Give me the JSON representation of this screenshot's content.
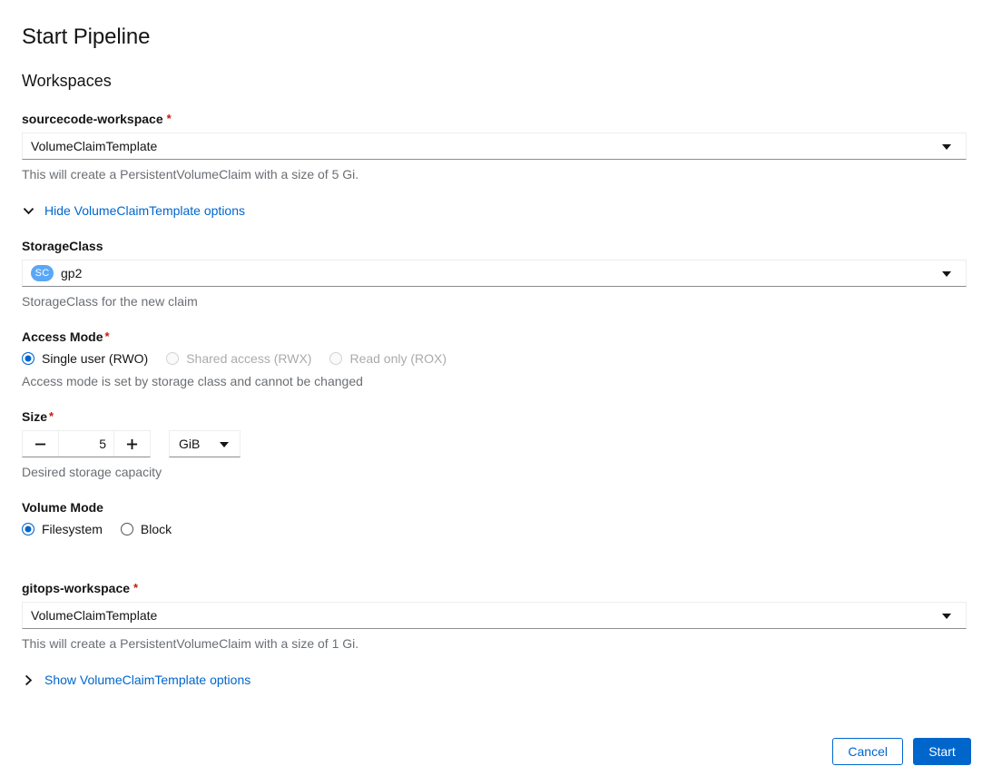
{
  "page": {
    "title": "Start Pipeline",
    "section_title": "Workspaces"
  },
  "colors": {
    "accent_blue": "#06c",
    "required_red": "#c9190b",
    "badge_blue": "#5ba7f7",
    "helper_gray": "#6a6e73",
    "disabled_gray": "#aaabac"
  },
  "workspaces": [
    {
      "name": "sourcecode-workspace",
      "required_marker": "*",
      "type_select": {
        "value": "VolumeClaimTemplate",
        "caret_icon": "chevron-down-icon"
      },
      "helper_text": "This will create a PersistentVolumeClaim with a size of 5 Gi.",
      "expandable": {
        "label": "Hide VolumeClaimTemplate options",
        "chevron_icon": "chevron-down-icon",
        "expanded": true
      },
      "options": {
        "storage_class": {
          "label": "StorageClass",
          "badge": "SC",
          "value": "gp2",
          "helper_text": "StorageClass for the new claim",
          "caret_icon": "chevron-down-icon"
        },
        "access_mode": {
          "label": "Access Mode",
          "required_marker": "*",
          "helper_text": "Access mode is set by storage class and cannot be changed",
          "options": [
            {
              "label": "Single user (RWO)",
              "checked": true,
              "disabled": false
            },
            {
              "label": "Shared access (RWX)",
              "checked": false,
              "disabled": true
            },
            {
              "label": "Read only (ROX)",
              "checked": false,
              "disabled": true
            }
          ]
        },
        "size": {
          "label": "Size",
          "required_marker": "*",
          "decrement_label": "−",
          "increment_label": "+",
          "value": "5",
          "unit": "GiB",
          "unit_caret_icon": "chevron-down-icon",
          "helper_text": "Desired storage capacity"
        },
        "volume_mode": {
          "label": "Volume Mode",
          "options": [
            {
              "label": "Filesystem",
              "checked": true,
              "disabled": false
            },
            {
              "label": "Block",
              "checked": false,
              "disabled": false
            }
          ]
        }
      }
    },
    {
      "name": "gitops-workspace",
      "required_marker": "*",
      "type_select": {
        "value": "VolumeClaimTemplate",
        "caret_icon": "chevron-down-icon"
      },
      "helper_text": "This will create a PersistentVolumeClaim with a size of 1 Gi.",
      "expandable": {
        "label": "Show VolumeClaimTemplate options",
        "chevron_icon": "chevron-right-icon",
        "expanded": false
      }
    }
  ],
  "footer": {
    "cancel_label": "Cancel",
    "start_label": "Start"
  }
}
